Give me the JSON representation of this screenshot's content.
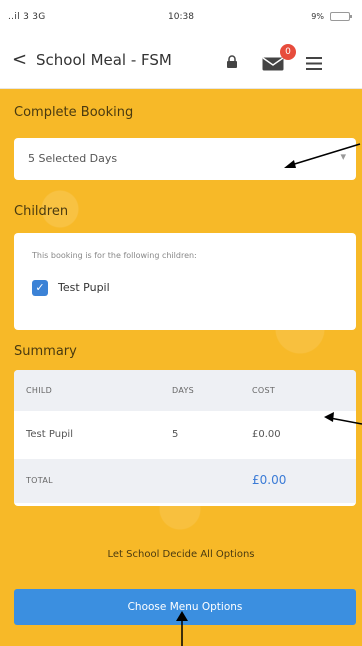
{
  "status_bar": {
    "signal": "..il 3 3G",
    "time": "10:38",
    "battery": "9%"
  },
  "header": {
    "back_label": "<",
    "title": "School Meal - FSM",
    "mail_badge_count": "0"
  },
  "booking": {
    "section_title": "Complete Booking",
    "selected_days": "5 Selected Days"
  },
  "children": {
    "section_title": "Children",
    "hint": "This booking is for the following children:",
    "items": [
      {
        "name": "Test Pupil",
        "checked": true
      }
    ]
  },
  "summary": {
    "section_title": "Summary",
    "columns": [
      "CHILD",
      "DAYS",
      "COST"
    ],
    "rows": [
      {
        "child": "Test Pupil",
        "days": "5",
        "cost": "£0.00"
      }
    ],
    "total_label": "TOTAL",
    "total_value": "£0.00"
  },
  "actions": {
    "let_school_decide": "Let School Decide All Options",
    "choose_menu": "Choose Menu Options"
  },
  "colors": {
    "background_yellow": "#f7b928",
    "button_blue": "#3b8fe0",
    "badge_red": "#e74c3c"
  }
}
